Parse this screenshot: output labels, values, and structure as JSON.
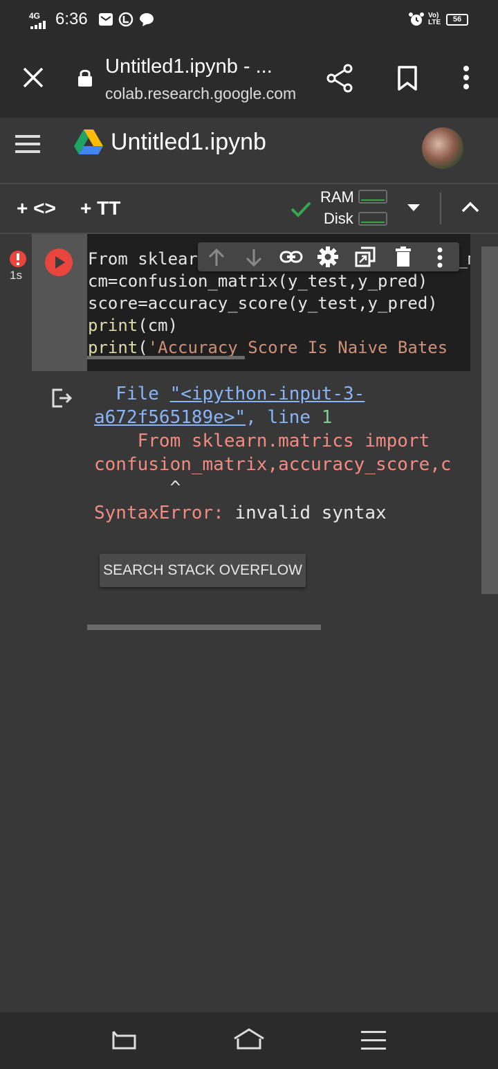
{
  "status_bar": {
    "network": "4G",
    "time": "6:36",
    "volte": "Vo) LTE",
    "battery": "56"
  },
  "browser": {
    "tab_title": "Untitled1.ipynb - ...",
    "url": "colab.research.google.com"
  },
  "colab": {
    "notebook_title": "Untitled1.ipynb",
    "toolbar": {
      "add_code": "+ <>",
      "add_text": "+ TT",
      "ram_label": "RAM",
      "disk_label": "Disk"
    }
  },
  "cell": {
    "exec_time": "1s",
    "code_lines": [
      "From sklearn.matrics import confusion_matrix,accuracy_score,classification_report",
      "cm=confusion_matrix(y_test,y_pred)",
      "score=accuracy_score(y_test,y_pred)",
      "print(cm)",
      "print('Accuracy Score Is Naive Bates"
    ],
    "code_print_1_kw": "print",
    "code_print_1_rest": "(cm)",
    "code_print_2_kw": "print",
    "code_print_2_paren": "(",
    "code_print_2_str": "'Accuracy Score Is Naive Bates",
    "output": {
      "file_label": "  File ",
      "file_link_1": "\"<ipython-input-3-",
      "file_link_2": "a672f565189e>\"",
      "line_label": ", line ",
      "line_number": "1",
      "error_line_1": "    From sklearn.matrics import",
      "error_line_2": "confusion_matrix,accuracy_score,c",
      "caret": "       ^",
      "error_type": "SyntaxError:",
      "error_message": " invalid syntax",
      "search_button": "SEARCH STACK OVERFLOW"
    }
  },
  "colors": {
    "run_button": "#e8453c",
    "error_text": "#f28b82",
    "link_text": "#8ab4f8",
    "connected_check": "#37a64f"
  }
}
